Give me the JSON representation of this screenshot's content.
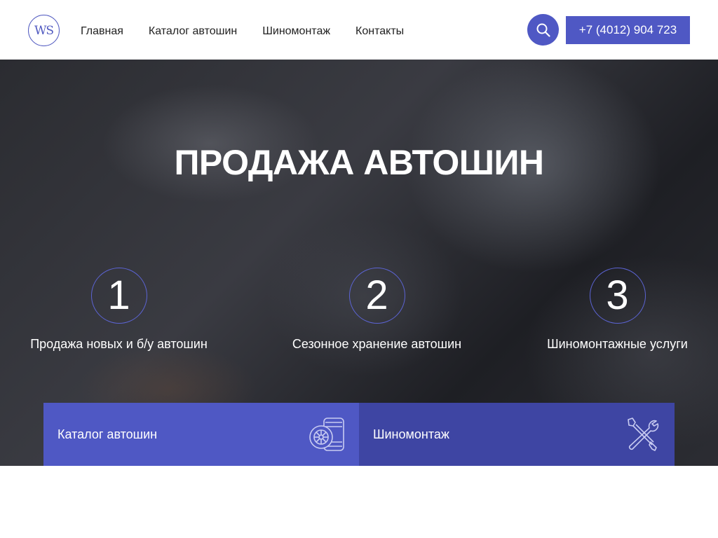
{
  "header": {
    "logo_text": "WS",
    "nav": [
      {
        "label": "Главная"
      },
      {
        "label": "Каталог автошин"
      },
      {
        "label": "Шиномонтаж"
      },
      {
        "label": "Контакты"
      }
    ],
    "search_icon": "search-icon",
    "phone": "+7 (4012) 904 723"
  },
  "hero": {
    "title": "ПРОДАЖА АВТОШИН",
    "features": [
      {
        "num": "1",
        "label": "Продажа новых и б/у автошин"
      },
      {
        "num": "2",
        "label": "Сезонное хранение автошин"
      },
      {
        "num": "3",
        "label": "Шиномонтажные услуги"
      }
    ]
  },
  "tiles": [
    {
      "label": "Каталог автошин",
      "icon": "tires-icon"
    },
    {
      "label": "Шиномонтаж",
      "icon": "wrench-screwdriver-icon"
    }
  ],
  "colors": {
    "accent": "#4f58c4",
    "accent_dark": "#3e45a3",
    "circle_border": "#5c64d4"
  }
}
